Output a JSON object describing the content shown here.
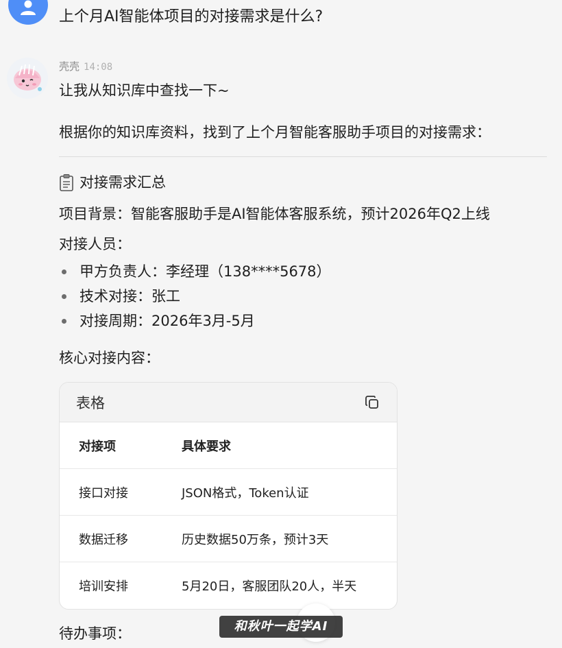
{
  "user": {
    "question": "上个月AI智能体项目的对接需求是什么?"
  },
  "assistant": {
    "name": "壳壳",
    "time": "14:08",
    "intro": "让我从知识库中查找一下~",
    "summary_line": "根据你的知识库资料，找到了上个月智能客服助手项目的对接需求：",
    "section_title": "对接需求汇总",
    "background": "项目背景：智能客服助手是AI智能体客服系统，预计2026年Q2上线",
    "people_label": "对接人员：",
    "people": [
      "甲方负责人：李经理（138****5678）",
      "技术对接：张工",
      "对接周期：2026年3月-5月"
    ],
    "core_label": "核心对接内容：",
    "table": {
      "title": "表格",
      "headers": [
        "对接项",
        "具体要求"
      ],
      "rows": [
        [
          "接口对接",
          "JSON格式，Token认证"
        ],
        [
          "数据迁移",
          "历史数据50万条，预计3天"
        ],
        [
          "培训安排",
          "5月20日，客服团队20人，半天"
        ]
      ]
    },
    "todo_label": "待办事项："
  },
  "watermark": "和秋叶一起学AI",
  "icons": {
    "user_avatar": "user-silhouette-icon",
    "bot_avatar": "shell-mascot-icon",
    "section": "clipboard-icon",
    "copy": "copy-icon"
  },
  "colors": {
    "user_avatar_bg": "#4f8ef7",
    "background": "#f5f5f5"
  }
}
